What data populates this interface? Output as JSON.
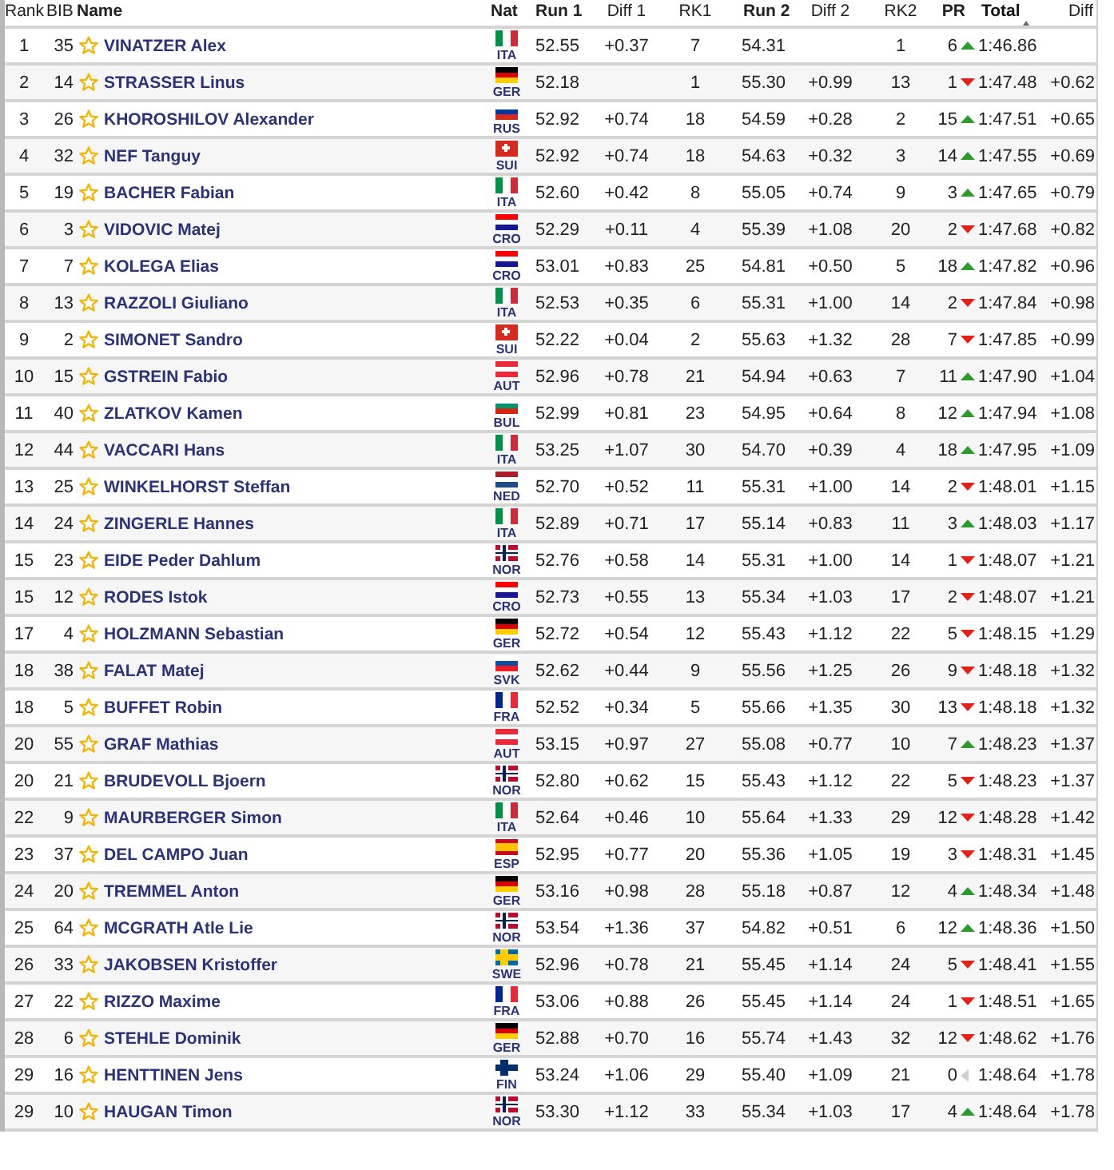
{
  "table": {
    "columns": [
      {
        "label": "Rank",
        "sorted": false
      },
      {
        "label": "BIB",
        "sorted": false
      },
      {
        "label": "Name",
        "sorted": false
      },
      {
        "label": "Nat",
        "sorted": false
      },
      {
        "label": "Run 1",
        "sorted": false
      },
      {
        "label": "Diff 1",
        "sorted": false
      },
      {
        "label": "RK1",
        "sorted": false
      },
      {
        "label": "Run 2",
        "sorted": false
      },
      {
        "label": "Diff 2",
        "sorted": false
      },
      {
        "label": "RK2",
        "sorted": false
      },
      {
        "label": "PR",
        "sorted": false
      },
      {
        "label": "Total",
        "sorted": true
      },
      {
        "label": "Diff",
        "sorted": false
      }
    ],
    "rows": [
      {
        "rank": "1",
        "bib": "35",
        "name": "VINATZER Alex",
        "nat": "ITA",
        "flag": {
          "kind": "vertical",
          "stripes": [
            {
              "color": "#009246"
            },
            {
              "color": "#ffffff"
            },
            {
              "color": "#ce2b37"
            }
          ]
        },
        "run1": "52.55",
        "diff1": "+0.37",
        "rk1": "7",
        "run2": "54.31",
        "rk2": "1",
        "pr": {
          "value": "6",
          "kind": "up"
        },
        "total": "1:46.86"
      },
      {
        "rank": "2",
        "bib": "14",
        "name": "STRASSER Linus",
        "nat": "GER",
        "flag": {
          "kind": "horizontal",
          "stripes": [
            {
              "color": "#000000"
            },
            {
              "color": "#dd0000"
            },
            {
              "color": "#ffce00"
            }
          ]
        },
        "run1": "52.18",
        "rk1": "1",
        "run2": "55.30",
        "diff2": "+0.99",
        "rk2": "13",
        "pr": {
          "value": "1",
          "kind": "down"
        },
        "total": "1:47.48",
        "diff": "+0.62"
      },
      {
        "rank": "3",
        "bib": "26",
        "name": "KHOROSHILOV Alexander",
        "nat": "RUS",
        "flag": {
          "kind": "horizontal",
          "stripes": [
            {
              "color": "#ffffff"
            },
            {
              "color": "#0039a6"
            },
            {
              "color": "#d52b1e"
            }
          ]
        },
        "run1": "52.92",
        "diff1": "+0.74",
        "rk1": "18",
        "run2": "54.59",
        "diff2": "+0.28",
        "rk2": "2",
        "pr": {
          "value": "15",
          "kind": "up"
        },
        "total": "1:47.51",
        "diff": "+0.65"
      },
      {
        "rank": "4",
        "bib": "32",
        "name": "NEF Tanguy",
        "nat": "SUI",
        "flag": {
          "kind": "plus",
          "stripes": [
            {
              "color": "#d52b1e"
            },
            {
              "color": "#ffffff"
            }
          ]
        },
        "run1": "52.92",
        "diff1": "+0.74",
        "rk1": "18",
        "run2": "54.63",
        "diff2": "+0.32",
        "rk2": "3",
        "pr": {
          "value": "14",
          "kind": "up"
        },
        "total": "1:47.55",
        "diff": "+0.69"
      },
      {
        "rank": "5",
        "bib": "19",
        "name": "BACHER Fabian",
        "nat": "ITA",
        "flag": {
          "kind": "vertical",
          "stripes": [
            {
              "color": "#009246"
            },
            {
              "color": "#ffffff"
            },
            {
              "color": "#ce2b37"
            }
          ]
        },
        "run1": "52.60",
        "diff1": "+0.42",
        "rk1": "8",
        "run2": "55.05",
        "diff2": "+0.74",
        "rk2": "9",
        "pr": {
          "value": "3",
          "kind": "up"
        },
        "total": "1:47.65",
        "diff": "+0.79"
      },
      {
        "rank": "6",
        "bib": "3",
        "name": "VIDOVIC Matej",
        "nat": "CRO",
        "flag": {
          "kind": "horizontal",
          "stripes": [
            {
              "color": "#ff0000"
            },
            {
              "color": "#ffffff"
            },
            {
              "color": "#171796"
            }
          ]
        },
        "run1": "52.29",
        "diff1": "+0.11",
        "rk1": "4",
        "run2": "55.39",
        "diff2": "+1.08",
        "rk2": "20",
        "pr": {
          "value": "2",
          "kind": "down"
        },
        "total": "1:47.68",
        "diff": "+0.82"
      },
      {
        "rank": "7",
        "bib": "7",
        "name": "KOLEGA Elias",
        "nat": "CRO",
        "flag": {
          "kind": "horizontal",
          "stripes": [
            {
              "color": "#ff0000"
            },
            {
              "color": "#ffffff"
            },
            {
              "color": "#171796"
            }
          ]
        },
        "run1": "53.01",
        "diff1": "+0.83",
        "rk1": "25",
        "run2": "54.81",
        "diff2": "+0.50",
        "rk2": "5",
        "pr": {
          "value": "18",
          "kind": "up"
        },
        "total": "1:47.82",
        "diff": "+0.96"
      },
      {
        "rank": "8",
        "bib": "13",
        "name": "RAZZOLI Giuliano",
        "nat": "ITA",
        "flag": {
          "kind": "vertical",
          "stripes": [
            {
              "color": "#009246"
            },
            {
              "color": "#ffffff"
            },
            {
              "color": "#ce2b37"
            }
          ]
        },
        "run1": "52.53",
        "diff1": "+0.35",
        "rk1": "6",
        "run2": "55.31",
        "diff2": "+1.00",
        "rk2": "14",
        "pr": {
          "value": "2",
          "kind": "down"
        },
        "total": "1:47.84",
        "diff": "+0.98"
      },
      {
        "rank": "9",
        "bib": "2",
        "name": "SIMONET Sandro",
        "nat": "SUI",
        "flag": {
          "kind": "plus",
          "stripes": [
            {
              "color": "#d52b1e"
            },
            {
              "color": "#ffffff"
            }
          ]
        },
        "run1": "52.22",
        "diff1": "+0.04",
        "rk1": "2",
        "run2": "55.63",
        "diff2": "+1.32",
        "rk2": "28",
        "pr": {
          "value": "7",
          "kind": "down"
        },
        "total": "1:47.85",
        "diff": "+0.99"
      },
      {
        "rank": "10",
        "bib": "15",
        "name": "GSTREIN Fabio",
        "nat": "AUT",
        "flag": {
          "kind": "horizontal",
          "stripes": [
            {
              "color": "#ed2939"
            },
            {
              "color": "#ffffff"
            },
            {
              "color": "#ed2939"
            }
          ]
        },
        "run1": "52.96",
        "diff1": "+0.78",
        "rk1": "21",
        "run2": "54.94",
        "diff2": "+0.63",
        "rk2": "7",
        "pr": {
          "value": "11",
          "kind": "up"
        },
        "total": "1:47.90",
        "diff": "+1.04"
      },
      {
        "rank": "11",
        "bib": "40",
        "name": "ZLATKOV Kamen",
        "nat": "BUL",
        "flag": {
          "kind": "horizontal",
          "stripes": [
            {
              "color": "#ffffff"
            },
            {
              "color": "#00966e"
            },
            {
              "color": "#d62612"
            }
          ]
        },
        "run1": "52.99",
        "diff1": "+0.81",
        "rk1": "23",
        "run2": "54.95",
        "diff2": "+0.64",
        "rk2": "8",
        "pr": {
          "value": "12",
          "kind": "up"
        },
        "total": "1:47.94",
        "diff": "+1.08"
      },
      {
        "rank": "12",
        "bib": "44",
        "name": "VACCARI Hans",
        "nat": "ITA",
        "flag": {
          "kind": "vertical",
          "stripes": [
            {
              "color": "#009246"
            },
            {
              "color": "#ffffff"
            },
            {
              "color": "#ce2b37"
            }
          ]
        },
        "run1": "53.25",
        "diff1": "+1.07",
        "rk1": "30",
        "run2": "54.70",
        "diff2": "+0.39",
        "rk2": "4",
        "pr": {
          "value": "18",
          "kind": "up"
        },
        "total": "1:47.95",
        "diff": "+1.09"
      },
      {
        "rank": "13",
        "bib": "25",
        "name": "WINKELHORST Steffan",
        "nat": "NED",
        "flag": {
          "kind": "horizontal",
          "stripes": [
            {
              "color": "#ae1c28"
            },
            {
              "color": "#ffffff"
            },
            {
              "color": "#21468b"
            }
          ]
        },
        "run1": "52.70",
        "diff1": "+0.52",
        "rk1": "11",
        "run2": "55.31",
        "diff2": "+1.00",
        "rk2": "14",
        "pr": {
          "value": "2",
          "kind": "down"
        },
        "total": "1:48.01",
        "diff": "+1.15"
      },
      {
        "rank": "14",
        "bib": "24",
        "name": "ZINGERLE Hannes",
        "nat": "ITA",
        "flag": {
          "kind": "vertical",
          "stripes": [
            {
              "color": "#009246"
            },
            {
              "color": "#ffffff"
            },
            {
              "color": "#ce2b37"
            }
          ]
        },
        "run1": "52.89",
        "diff1": "+0.71",
        "rk1": "17",
        "run2": "55.14",
        "diff2": "+0.83",
        "rk2": "11",
        "pr": {
          "value": "3",
          "kind": "up"
        },
        "total": "1:48.03",
        "diff": "+1.17"
      },
      {
        "rank": "15",
        "bib": "23",
        "name": "EIDE Peder Dahlum",
        "nat": "NOR",
        "flag": {
          "kind": "nordic",
          "stripes": [
            {
              "color": "#ba0c2f"
            },
            {
              "color": "#ffffff"
            },
            {
              "color": "#00205b"
            }
          ]
        },
        "run1": "52.76",
        "diff1": "+0.58",
        "rk1": "14",
        "run2": "55.31",
        "diff2": "+1.00",
        "rk2": "14",
        "pr": {
          "value": "1",
          "kind": "down"
        },
        "total": "1:48.07",
        "diff": "+1.21"
      },
      {
        "rank": "15",
        "bib": "12",
        "name": "RODES Istok",
        "nat": "CRO",
        "flag": {
          "kind": "horizontal",
          "stripes": [
            {
              "color": "#ff0000"
            },
            {
              "color": "#ffffff"
            },
            {
              "color": "#171796"
            }
          ]
        },
        "run1": "52.73",
        "diff1": "+0.55",
        "rk1": "13",
        "run2": "55.34",
        "diff2": "+1.03",
        "rk2": "17",
        "pr": {
          "value": "2",
          "kind": "down"
        },
        "total": "1:48.07",
        "diff": "+1.21"
      },
      {
        "rank": "17",
        "bib": "4",
        "name": "HOLZMANN Sebastian",
        "nat": "GER",
        "flag": {
          "kind": "horizontal",
          "stripes": [
            {
              "color": "#000000"
            },
            {
              "color": "#dd0000"
            },
            {
              "color": "#ffce00"
            }
          ]
        },
        "run1": "52.72",
        "diff1": "+0.54",
        "rk1": "12",
        "run2": "55.43",
        "diff2": "+1.12",
        "rk2": "22",
        "pr": {
          "value": "5",
          "kind": "down"
        },
        "total": "1:48.15",
        "diff": "+1.29"
      },
      {
        "rank": "18",
        "bib": "38",
        "name": "FALAT Matej",
        "nat": "SVK",
        "flag": {
          "kind": "horizontal",
          "stripes": [
            {
              "color": "#ffffff"
            },
            {
              "color": "#0b4ea2"
            },
            {
              "color": "#ee1c25"
            }
          ]
        },
        "run1": "52.62",
        "diff1": "+0.44",
        "rk1": "9",
        "run2": "55.56",
        "diff2": "+1.25",
        "rk2": "26",
        "pr": {
          "value": "9",
          "kind": "down"
        },
        "total": "1:48.18",
        "diff": "+1.32"
      },
      {
        "rank": "18",
        "bib": "5",
        "name": "BUFFET Robin",
        "nat": "FRA",
        "flag": {
          "kind": "vertical",
          "stripes": [
            {
              "color": "#002395"
            },
            {
              "color": "#ffffff"
            },
            {
              "color": "#ed2939"
            }
          ]
        },
        "run1": "52.52",
        "diff1": "+0.34",
        "rk1": "5",
        "run2": "55.66",
        "diff2": "+1.35",
        "rk2": "30",
        "pr": {
          "value": "13",
          "kind": "down"
        },
        "total": "1:48.18",
        "diff": "+1.32"
      },
      {
        "rank": "20",
        "bib": "55",
        "name": "GRAF Mathias",
        "nat": "AUT",
        "flag": {
          "kind": "horizontal",
          "stripes": [
            {
              "color": "#ed2939"
            },
            {
              "color": "#ffffff"
            },
            {
              "color": "#ed2939"
            }
          ]
        },
        "run1": "53.15",
        "diff1": "+0.97",
        "rk1": "27",
        "run2": "55.08",
        "diff2": "+0.77",
        "rk2": "10",
        "pr": {
          "value": "7",
          "kind": "up"
        },
        "total": "1:48.23",
        "diff": "+1.37"
      },
      {
        "rank": "20",
        "bib": "21",
        "name": "BRUDEVOLL Bjoern",
        "nat": "NOR",
        "flag": {
          "kind": "nordic",
          "stripes": [
            {
              "color": "#ba0c2f"
            },
            {
              "color": "#ffffff"
            },
            {
              "color": "#00205b"
            }
          ]
        },
        "run1": "52.80",
        "diff1": "+0.62",
        "rk1": "15",
        "run2": "55.43",
        "diff2": "+1.12",
        "rk2": "22",
        "pr": {
          "value": "5",
          "kind": "down"
        },
        "total": "1:48.23",
        "diff": "+1.37"
      },
      {
        "rank": "22",
        "bib": "9",
        "name": "MAURBERGER Simon",
        "nat": "ITA",
        "flag": {
          "kind": "vertical",
          "stripes": [
            {
              "color": "#009246"
            },
            {
              "color": "#ffffff"
            },
            {
              "color": "#ce2b37"
            }
          ]
        },
        "run1": "52.64",
        "diff1": "+0.46",
        "rk1": "10",
        "run2": "55.64",
        "diff2": "+1.33",
        "rk2": "29",
        "pr": {
          "value": "12",
          "kind": "down"
        },
        "total": "1:48.28",
        "diff": "+1.42"
      },
      {
        "rank": "23",
        "bib": "37",
        "name": "DEL CAMPO Juan",
        "nat": "ESP",
        "flag": {
          "kind": "horizontal",
          "stripes": [
            {
              "color": "#c60b1e"
            },
            {
              "color": "#ffc400"
            },
            {
              "color": "#ffc400"
            },
            {
              "color": "#c60b1e"
            }
          ]
        },
        "run1": "52.95",
        "diff1": "+0.77",
        "rk1": "20",
        "run2": "55.36",
        "diff2": "+1.05",
        "rk2": "19",
        "pr": {
          "value": "3",
          "kind": "down"
        },
        "total": "1:48.31",
        "diff": "+1.45"
      },
      {
        "rank": "24",
        "bib": "20",
        "name": "TREMMEL Anton",
        "nat": "GER",
        "flag": {
          "kind": "horizontal",
          "stripes": [
            {
              "color": "#000000"
            },
            {
              "color": "#dd0000"
            },
            {
              "color": "#ffce00"
            }
          ]
        },
        "run1": "53.16",
        "diff1": "+0.98",
        "rk1": "28",
        "run2": "55.18",
        "diff2": "+0.87",
        "rk2": "12",
        "pr": {
          "value": "4",
          "kind": "up"
        },
        "total": "1:48.34",
        "diff": "+1.48"
      },
      {
        "rank": "25",
        "bib": "64",
        "name": "MCGRATH Atle Lie",
        "nat": "NOR",
        "flag": {
          "kind": "nordic",
          "stripes": [
            {
              "color": "#ba0c2f"
            },
            {
              "color": "#ffffff"
            },
            {
              "color": "#00205b"
            }
          ]
        },
        "run1": "53.54",
        "diff1": "+1.36",
        "rk1": "37",
        "run2": "54.82",
        "diff2": "+0.51",
        "rk2": "6",
        "pr": {
          "value": "12",
          "kind": "up"
        },
        "total": "1:48.36",
        "diff": "+1.50"
      },
      {
        "rank": "26",
        "bib": "33",
        "name": "JAKOBSEN Kristoffer",
        "nat": "SWE",
        "flag": {
          "kind": "nordic",
          "stripes": [
            {
              "color": "#006aa7"
            },
            {
              "color": "#fecc00"
            }
          ]
        },
        "run1": "52.96",
        "diff1": "+0.78",
        "rk1": "21",
        "run2": "55.45",
        "diff2": "+1.14",
        "rk2": "24",
        "pr": {
          "value": "5",
          "kind": "down"
        },
        "total": "1:48.41",
        "diff": "+1.55"
      },
      {
        "rank": "27",
        "bib": "22",
        "name": "RIZZO Maxime",
        "nat": "FRA",
        "flag": {
          "kind": "vertical",
          "stripes": [
            {
              "color": "#002395"
            },
            {
              "color": "#ffffff"
            },
            {
              "color": "#ed2939"
            }
          ]
        },
        "run1": "53.06",
        "diff1": "+0.88",
        "rk1": "26",
        "run2": "55.45",
        "diff2": "+1.14",
        "rk2": "24",
        "pr": {
          "value": "1",
          "kind": "down"
        },
        "total": "1:48.51",
        "diff": "+1.65"
      },
      {
        "rank": "28",
        "bib": "6",
        "name": "STEHLE Dominik",
        "nat": "GER",
        "flag": {
          "kind": "horizontal",
          "stripes": [
            {
              "color": "#000000"
            },
            {
              "color": "#dd0000"
            },
            {
              "color": "#ffce00"
            }
          ]
        },
        "run1": "52.88",
        "diff1": "+0.70",
        "rk1": "16",
        "run2": "55.74",
        "diff2": "+1.43",
        "rk2": "32",
        "pr": {
          "value": "12",
          "kind": "down"
        },
        "total": "1:48.62",
        "diff": "+1.76"
      },
      {
        "rank": "29",
        "bib": "16",
        "name": "HENTTINEN Jens",
        "nat": "FIN",
        "flag": {
          "kind": "nordic",
          "stripes": [
            {
              "color": "#ffffff"
            },
            {
              "color": "#002f6c"
            }
          ]
        },
        "run1": "53.24",
        "diff1": "+1.06",
        "rk1": "29",
        "run2": "55.40",
        "diff2": "+1.09",
        "rk2": "21",
        "pr": {
          "value": "0",
          "kind": "same"
        },
        "total": "1:48.64",
        "diff": "+1.78"
      },
      {
        "rank": "29",
        "bib": "10",
        "name": "HAUGAN Timon",
        "nat": "NOR",
        "flag": {
          "kind": "nordic",
          "stripes": [
            {
              "color": "#ba0c2f"
            },
            {
              "color": "#ffffff"
            },
            {
              "color": "#00205b"
            }
          ]
        },
        "run1": "53.30",
        "diff1": "+1.12",
        "rk1": "33",
        "run2": "55.34",
        "diff2": "+1.03",
        "rk2": "17",
        "pr": {
          "value": "4",
          "kind": "up"
        },
        "total": "1:48.64",
        "diff": "+1.78"
      }
    ]
  }
}
